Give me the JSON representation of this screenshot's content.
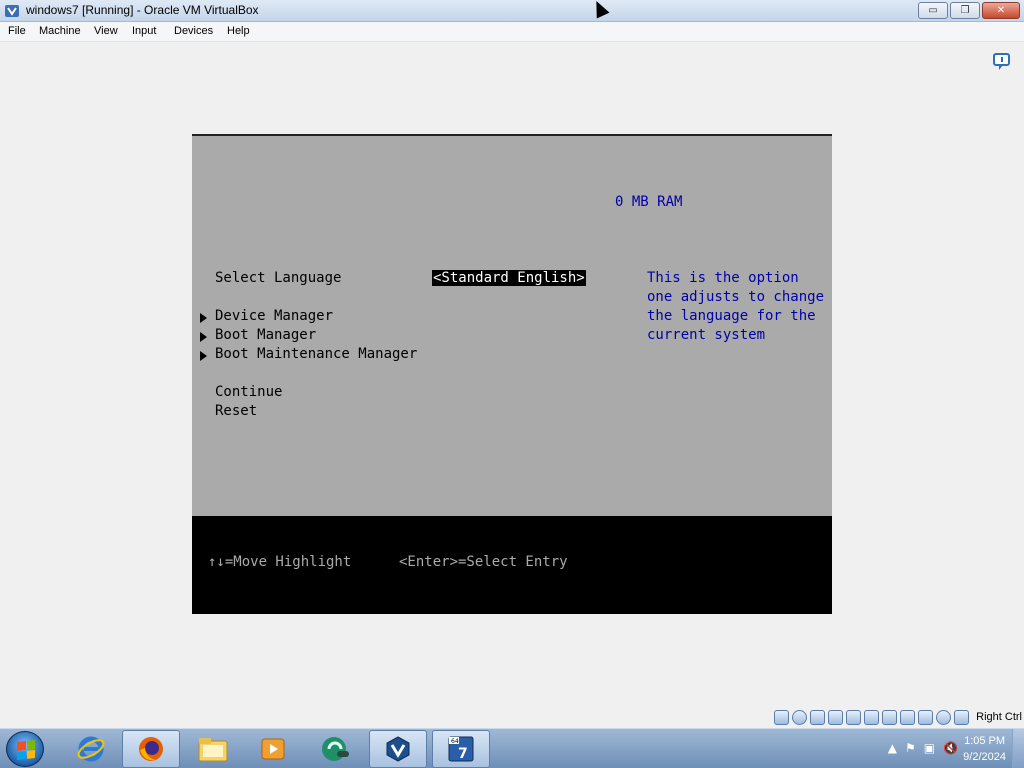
{
  "window": {
    "title": "windows7 [Running] - Oracle VM VirtualBox",
    "buttons": {
      "minimize": "▭",
      "restore": "❐",
      "close": "✕"
    }
  },
  "menu": [
    "File",
    "Machine",
    "View",
    "Input",
    "Devices",
    "Help"
  ],
  "bios": {
    "ram": "0 MB RAM",
    "select_language_label": "Select Language",
    "select_language_value": "<Standard English>",
    "help_lines": [
      "This is the option",
      "one adjusts to change",
      "the language for the",
      "current system"
    ],
    "submenus": [
      "Device Manager",
      "Boot Manager",
      "Boot Maintenance Manager"
    ],
    "actions": [
      "Continue",
      "Reset"
    ],
    "footer": {
      "move": "↑↓=Move Highlight",
      "select": "<Enter>=Select Entry"
    },
    "colors": {
      "background": "#aaaaaa",
      "blue_text": "#0000aa",
      "footer": "#000000"
    }
  },
  "statusbar": {
    "host_key": "Right Ctrl",
    "icons": [
      "hard-disk-icon",
      "optical-drive-icon",
      "audio-icon",
      "network-icon",
      "usb-icon",
      "shared-folders-icon",
      "display-icon",
      "video-capture-icon",
      "cpu-icon",
      "mouse-integration-icon",
      "keyboard-icon"
    ]
  },
  "taskbar": {
    "apps": [
      "internet-explorer-icon",
      "firefox-icon",
      "file-explorer-icon",
      "media-player-icon",
      "green-app-icon",
      "virtualbox-icon",
      "windows7-vm-icon"
    ],
    "time": "1:05 PM",
    "date": "9/2/2024",
    "tray_icons": [
      "show-hidden-icons",
      "action-center-flag-icon",
      "network-icon",
      "volume-muted-icon"
    ]
  }
}
